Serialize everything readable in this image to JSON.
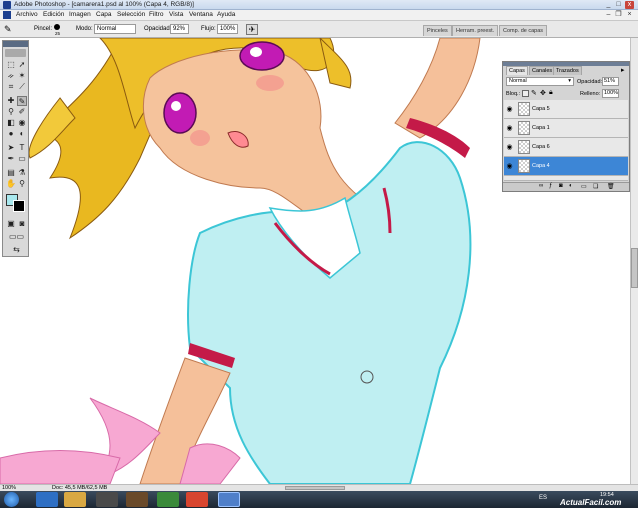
{
  "window": {
    "title": "Adobe Photoshop - [camarera1.psd al 100% (Capa 4, RGB/8)]",
    "controls": [
      "_",
      "□",
      "x"
    ]
  },
  "menu": [
    "Archivo",
    "Edición",
    "Imagen",
    "Capa",
    "Selección",
    "Filtro",
    "Vista",
    "Ventana",
    "Ayuda"
  ],
  "options_bar": {
    "brush_label": "Pincel:",
    "brush_size": "25",
    "mode_label": "Modo:",
    "mode_value": "Normal",
    "opacity_label": "Opacidad:",
    "opacity_value": "92%",
    "flow_label": "Flujo:",
    "flow_value": "100%",
    "palette_tabs": [
      "Pinceles",
      "Herram. preest.",
      "Comp. de capas"
    ]
  },
  "layers_panel": {
    "tabs": [
      "Capas",
      "Canales",
      "Trazados"
    ],
    "blend_mode": "Normal",
    "opacity_label": "Opacidad:",
    "opacity_value": "51%",
    "lock_label": "Bloq.:",
    "fill_label": "Relleno:",
    "fill_value": "100%",
    "layers": [
      {
        "name": "Capa 5",
        "visible": true,
        "selected": false
      },
      {
        "name": "Capa 1",
        "visible": true,
        "selected": false
      },
      {
        "name": "Capa 6",
        "visible": true,
        "selected": false
      },
      {
        "name": "Capa 4",
        "visible": true,
        "selected": true
      }
    ]
  },
  "status_bar": {
    "zoom": "100%",
    "doc_info": "Doc: 45,5 MB/62,5 MB"
  },
  "taskbar": {
    "language": "ES",
    "time": "19:54",
    "watermark": "ActualFacil.com"
  },
  "colors": {
    "foreground": "#000000",
    "background": "#a8e8ee",
    "layer_selected": "#3d86d6"
  }
}
